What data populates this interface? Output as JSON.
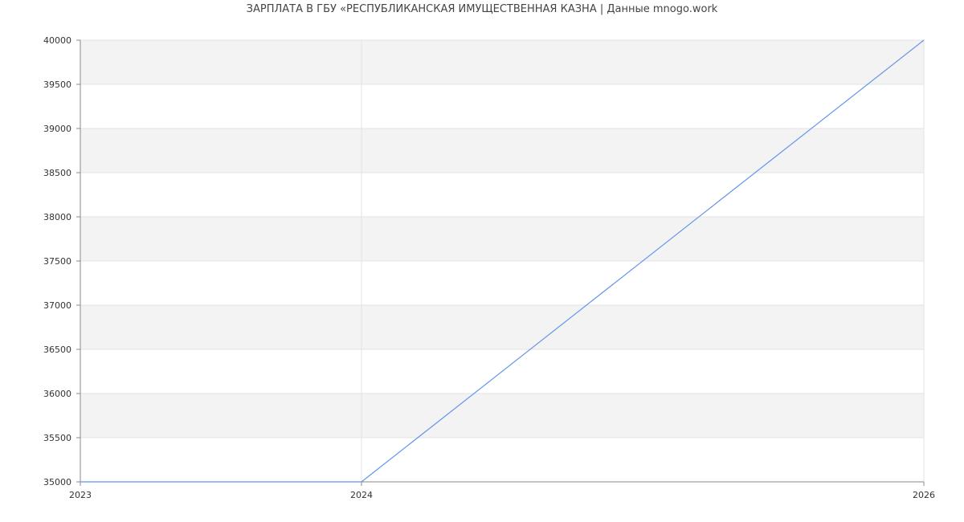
{
  "chart_data": {
    "type": "line",
    "title": "ЗАРПЛАТА В ГБУ «РЕСПУБЛИКАНСКАЯ ИМУЩЕСТВЕННАЯ КАЗНА | Данные mnogo.work",
    "xlabel": "",
    "ylabel": "",
    "x": [
      2023,
      2024,
      2026
    ],
    "series": [
      {
        "values": [
          35000,
          35000,
          40000
        ]
      }
    ],
    "x_ticks": [
      "2023",
      "2024",
      "2026"
    ],
    "y_ticks": [
      "35000",
      "35500",
      "36000",
      "36500",
      "37000",
      "37500",
      "38000",
      "38500",
      "39000",
      "39500",
      "40000"
    ],
    "ylim": [
      35000,
      40000
    ],
    "grid": true,
    "legend": "none",
    "colors": {
      "line": "#6495ed",
      "band": "#f3f3f3",
      "grid": "#e3e3e3",
      "axis": "#888888"
    }
  }
}
